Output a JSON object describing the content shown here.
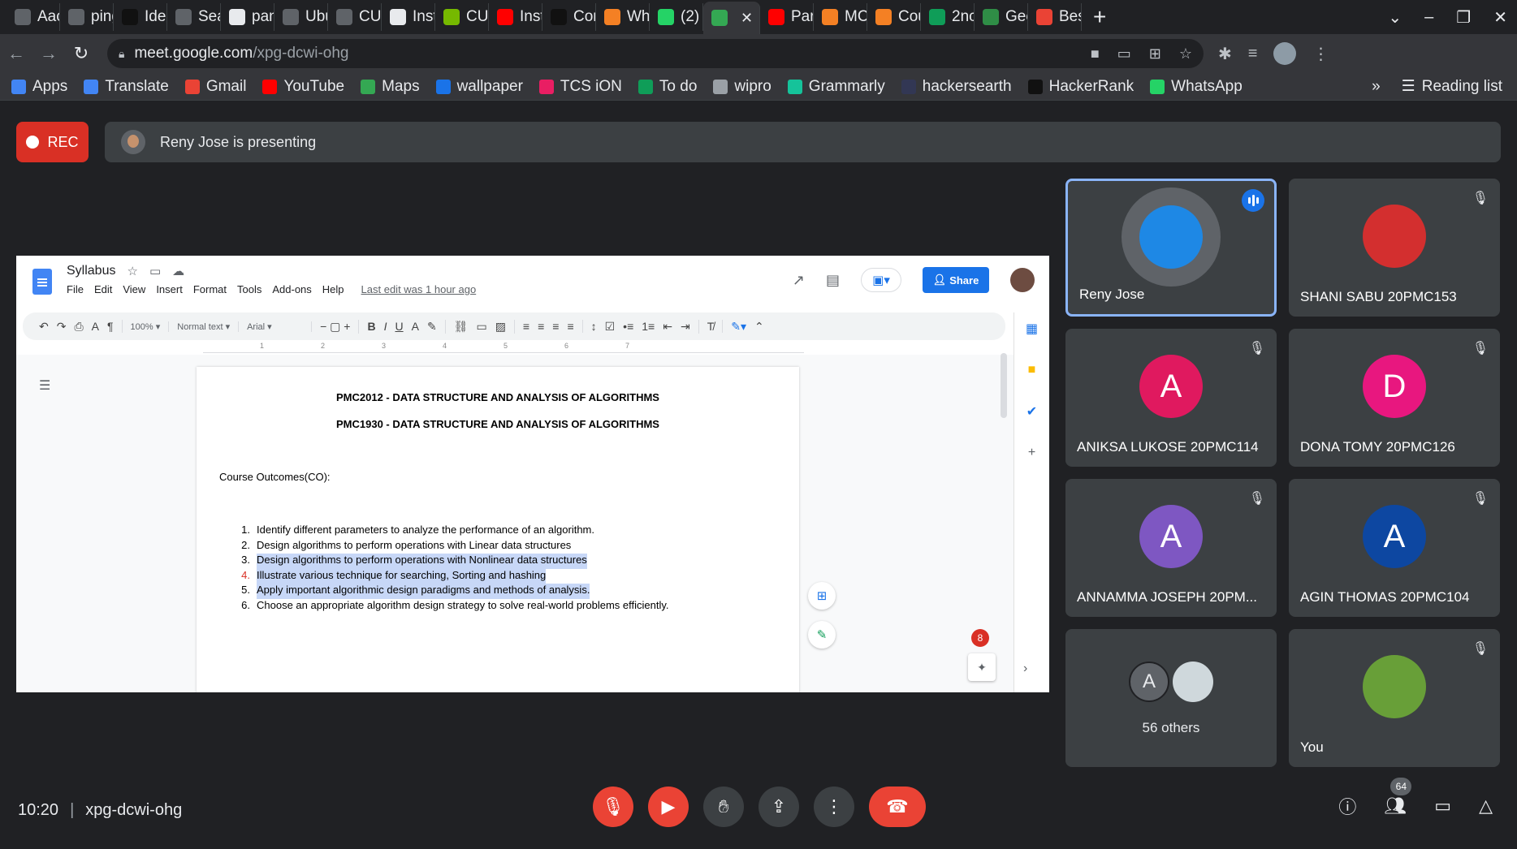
{
  "browser": {
    "tabs": [
      {
        "title": "Aac",
        "color": "#5f6368"
      },
      {
        "title": "ping",
        "color": "#5f6368"
      },
      {
        "title": "Ider",
        "color": "#111111"
      },
      {
        "title": "Sea",
        "color": "#5f6368"
      },
      {
        "title": "pan",
        "color": "#e8eaed"
      },
      {
        "title": "Ubu",
        "color": "#5f6368"
      },
      {
        "title": "CUI",
        "color": "#5f6368"
      },
      {
        "title": "Inst",
        "color": "#e8eaed"
      },
      {
        "title": "CUI",
        "color": "#76b900"
      },
      {
        "title": "Inst",
        "color": "#ff0000"
      },
      {
        "title": "Cor",
        "color": "#111111"
      },
      {
        "title": "Wh",
        "color": "#f48024"
      },
      {
        "title": "(2)",
        "color": "#25d366"
      },
      {
        "title": "",
        "color": "#34a853",
        "active": true
      },
      {
        "title": "Par",
        "color": "#ff0000"
      },
      {
        "title": "MC",
        "color": "#f48024"
      },
      {
        "title": "Cou",
        "color": "#f48024"
      },
      {
        "title": "2nc",
        "color": "#0f9d58"
      },
      {
        "title": "Gee",
        "color": "#2f8d46"
      },
      {
        "title": "Bes",
        "color": "#ea4335"
      }
    ],
    "url_host": "meet.google.com",
    "url_path": "/xpg-dcwi-ohg",
    "bookmarks": [
      {
        "label": "Apps",
        "color": "#4285f4"
      },
      {
        "label": "Translate",
        "color": "#4285f4"
      },
      {
        "label": "Gmail",
        "color": "#ea4335"
      },
      {
        "label": "YouTube",
        "color": "#ff0000"
      },
      {
        "label": "Maps",
        "color": "#34a853"
      },
      {
        "label": "wallpaper",
        "color": "#1a73e8"
      },
      {
        "label": "TCS iON",
        "color": "#e91e63"
      },
      {
        "label": "To do",
        "color": "#0f9d58"
      },
      {
        "label": "wipro",
        "color": "#9aa0a6"
      },
      {
        "label": "Grammarly",
        "color": "#15c39a"
      },
      {
        "label": "hackersearth",
        "color": "#323754"
      },
      {
        "label": "HackerRank",
        "color": "#111111"
      },
      {
        "label": "WhatsApp",
        "color": "#25d366"
      }
    ],
    "reading_list": "Reading list",
    "more_bookmarks": "»"
  },
  "meet": {
    "rec_label": "REC",
    "presenting_text": "Reny Jose is presenting",
    "meeting_code": "xpg-dcwi-ohg",
    "time": "10:20",
    "people_count": "64",
    "participants": [
      {
        "name": "Reny Jose",
        "type": "photo",
        "active": true
      },
      {
        "name": "SHANI SABU 20PMC153",
        "type": "photo"
      },
      {
        "name": "ANIKSA LUKOSE 20PMC114",
        "letter": "A",
        "color": "#e0195f"
      },
      {
        "name": "DONA TOMY 20PMC126",
        "letter": "D",
        "color": "#e8177f"
      },
      {
        "name": "ANNAMMA JOSEPH 20PM...",
        "letter": "A",
        "color": "#7e57c2"
      },
      {
        "name": "AGIN THOMAS 20PMC104",
        "letter": "A",
        "color": "#0d47a1"
      },
      {
        "name": "56 others",
        "type": "others",
        "letter": "A"
      },
      {
        "name": "You",
        "type": "photo"
      }
    ]
  },
  "docs": {
    "title": "Syllabus",
    "menu": [
      "File",
      "Edit",
      "View",
      "Insert",
      "Format",
      "Tools",
      "Add-ons",
      "Help"
    ],
    "last_edit": "Last edit was 1 hour ago",
    "share_label": "Share",
    "zoom": "100%",
    "style": "Normal text",
    "font": "Arial",
    "heading1": "PMC2012 - DATA STRUCTURE AND ANALYSIS OF ALGORITHMS",
    "heading2": "PMC1930 - DATA STRUCTURE AND ANALYSIS OF ALGORITHMS",
    "course_outcomes_label": "Course Outcomes(CO):",
    "outcomes": [
      {
        "num": "1.",
        "text": "Identify different parameters to analyze the performance of an algorithm.",
        "highlight": false
      },
      {
        "num": "2.",
        "text": "Design algorithms to perform operations with Linear  data structures",
        "highlight": false
      },
      {
        "num": "3.",
        "text": "Design algorithms to perform operations with  Nonlinear data structures",
        "highlight": true
      },
      {
        "num": "4.",
        "text": "Illustrate various technique for searching, Sorting and hashing",
        "highlight": true
      },
      {
        "num": "5.",
        "text": "Apply important algorithmic design paradigms and methods of analysis.",
        "highlight": true
      },
      {
        "num": "6.",
        "text": "Choose an appropriate algorithm design strategy to solve real-world problems efficiently.",
        "highlight": false
      }
    ],
    "ruler_marks": [
      "1",
      "2",
      "3",
      "4",
      "5",
      "6",
      "7"
    ],
    "comment_badge": "8"
  }
}
